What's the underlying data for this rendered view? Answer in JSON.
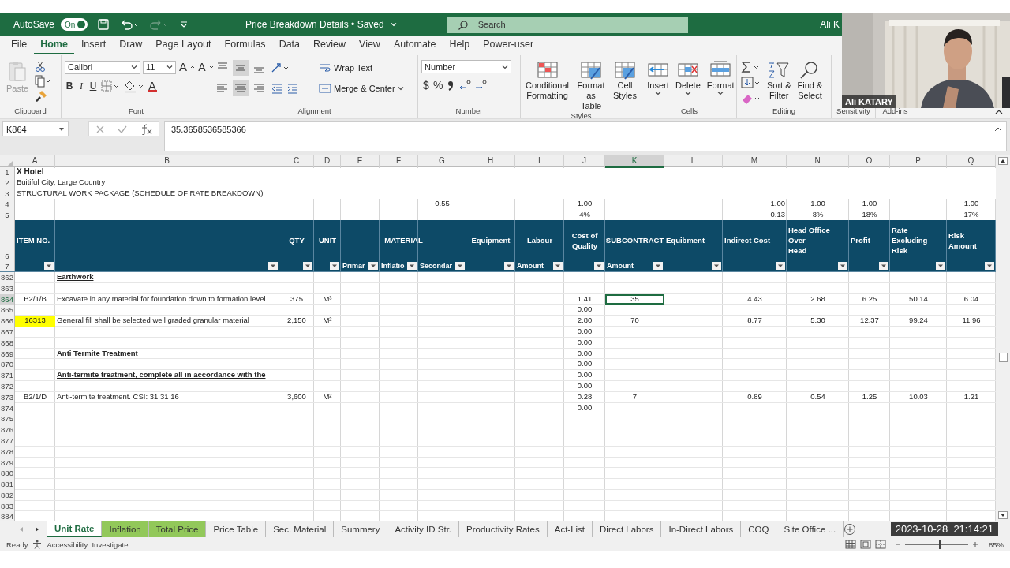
{
  "title_bar": {
    "autosave_label": "AutoSave",
    "autosave_on": true,
    "autosave_state": "On",
    "document_title": "Price Breakdown Details • Saved",
    "search_placeholder": "Search",
    "user_name": "Ali K"
  },
  "menu_tabs": [
    {
      "label": "File",
      "selected": false
    },
    {
      "label": "Home",
      "selected": true
    },
    {
      "label": "Insert",
      "selected": false
    },
    {
      "label": "Draw",
      "selected": false
    },
    {
      "label": "Page Layout",
      "selected": false
    },
    {
      "label": "Formulas",
      "selected": false
    },
    {
      "label": "Data",
      "selected": false
    },
    {
      "label": "Review",
      "selected": false
    },
    {
      "label": "View",
      "selected": false
    },
    {
      "label": "Automate",
      "selected": false
    },
    {
      "label": "Help",
      "selected": false
    },
    {
      "label": "Power-user",
      "selected": false
    }
  ],
  "ribbon": {
    "clipboard": {
      "label": "Clipboard",
      "paste": "Paste"
    },
    "font": {
      "label": "Font",
      "font_name": "Calibri",
      "font_size": "11",
      "grow": "A",
      "shrink": "A",
      "bold": "B",
      "italic": "I",
      "underline": "U",
      "font_color": "A"
    },
    "alignment": {
      "label": "Alignment",
      "wrap_text": "Wrap Text",
      "merge_center": "Merge & Center",
      "middle_align_on": true,
      "center_align_on": true
    },
    "number": {
      "label": "Number",
      "format": "Number",
      "currency": "$",
      "percent": "%"
    },
    "styles": {
      "label": "Styles",
      "buttons": [
        "Conditional\nFormatting",
        "Format as\nTable",
        "Cell\nStyles"
      ]
    },
    "cells": {
      "label": "Cells",
      "buttons": [
        "Insert",
        "Delete",
        "Format"
      ]
    },
    "editing": {
      "label": "Editing",
      "buttons": [
        "Sort &\nFilter",
        "Find &\nSelect"
      ]
    },
    "sensitivity": {
      "label": "Sensitivity"
    },
    "add_ins": {
      "label": "Add-ins"
    }
  },
  "webcam": {
    "name_label": "Ali KATARY"
  },
  "formula_bar": {
    "name_box": "K864",
    "formula": "35.3658536585366"
  },
  "columns": [
    {
      "letter": "A",
      "selected": false
    },
    {
      "letter": "B",
      "selected": false
    },
    {
      "letter": "C",
      "selected": false
    },
    {
      "letter": "D",
      "selected": false
    },
    {
      "letter": "E",
      "selected": false
    },
    {
      "letter": "F",
      "selected": false
    },
    {
      "letter": "G",
      "selected": false
    },
    {
      "letter": "H",
      "selected": false
    },
    {
      "letter": "I",
      "selected": false
    },
    {
      "letter": "J",
      "selected": false
    },
    {
      "letter": "K",
      "selected": true
    },
    {
      "letter": "L",
      "selected": false
    },
    {
      "letter": "M",
      "selected": false
    },
    {
      "letter": "N",
      "selected": false
    },
    {
      "letter": "O",
      "selected": false
    },
    {
      "letter": "P",
      "selected": false
    },
    {
      "letter": "Q",
      "selected": false
    }
  ],
  "top_rows": [
    {
      "row": "1",
      "kind": "title",
      "item_no": "X Hotel"
    },
    {
      "row": "2",
      "kind": "text",
      "item_no": "Buitiful City, Large Country"
    },
    {
      "row": "3",
      "kind": "text",
      "item_no": "STRUCTURAL WORK PACKAGE (SCHEDULE OF RATE BREAKDOWN)"
    },
    {
      "row": "4",
      "kind": "values",
      "secondary": "0.55",
      "cost_of_quality": "1.00",
      "indirect_cost": "1.00",
      "head_office_overhead": "1.00",
      "profit": "1.00",
      "risk_amount": "1.00"
    },
    {
      "row": "5",
      "kind": "values",
      "cost_of_quality": "4%",
      "indirect_cost": "0.13",
      "head_office_overhead": "8%",
      "profit": "18%",
      "risk_amount": "17%"
    }
  ],
  "header_row": {
    "row": "6",
    "cells": {
      "item_no": "ITEM NO.",
      "qty": "QTY",
      "unit": "UNIT",
      "material": "MATERIAL",
      "equipment": "Equipment",
      "labour": "Labour",
      "cost_of_quality": "Cost of\nQuality",
      "subcontract": "SUBCONTRACT",
      "equibment": "Equibment",
      "indirect_cost": "Indirect Cost",
      "head_office_overhead": "Head Office\nOver\nHead",
      "profit": "Profit",
      "rate_excluding_risk": "Rate\nExcluding Risk",
      "risk_amount": "Risk\nAmount"
    }
  },
  "filter_row": {
    "row": "7",
    "cells": {
      "primary": "Primar",
      "inflation": "Inflatio",
      "secondary": "Secondar",
      "labour": "Amount",
      "subcontract": "Amount"
    }
  },
  "rows": [
    {
      "row": "862",
      "selected": false,
      "heading": true,
      "description": "Earthwork"
    },
    {
      "row": "863",
      "selected": false
    },
    {
      "row": "864",
      "selected": true,
      "highlighted": false,
      "heading": false,
      "item_no": "B2/1/B",
      "description": "Excavate in any material for foundation down to formation level",
      "qty": "375",
      "unit": "M³",
      "cost_of_quality": "1.41",
      "subcontract": "35",
      "indirect_cost": "4.43",
      "head_office_overhead": "2.68",
      "profit": "6.25",
      "rate_excluding_risk": "50.14",
      "risk_amount": "6.04"
    },
    {
      "row": "865",
      "selected": false,
      "cost_of_quality": "0.00"
    },
    {
      "row": "866",
      "selected": false,
      "highlighted": true,
      "heading": false,
      "item_no": "16313",
      "description": "General fill shall be selected well graded granular material",
      "qty": "2,150",
      "unit": "M²",
      "cost_of_quality": "2.80",
      "subcontract": "70",
      "indirect_cost": "8.77",
      "head_office_overhead": "5.30",
      "profit": "12.37",
      "rate_excluding_risk": "99.24",
      "risk_amount": "11.96"
    },
    {
      "row": "867",
      "selected": false,
      "cost_of_quality": "0.00"
    },
    {
      "row": "868",
      "selected": false,
      "cost_of_quality": "0.00"
    },
    {
      "row": "869",
      "selected": false,
      "heading": true,
      "description": "Anti Termite Treatment",
      "cost_of_quality": "0.00"
    },
    {
      "row": "870",
      "selected": false,
      "cost_of_quality": "0.00"
    },
    {
      "row": "871",
      "selected": false,
      "heading": true,
      "description": "Anti-termite treatment, complete all in accordance with the ",
      "cost_of_quality": "0.00"
    },
    {
      "row": "872",
      "selected": false,
      "cost_of_quality": "0.00"
    },
    {
      "row": "873",
      "selected": false,
      "highlighted": false,
      "heading": false,
      "item_no": "B2/1/D",
      "description": "Anti-termite treatment. CSI: 31 31 16",
      "qty": "3,600",
      "unit": "M²",
      "cost_of_quality": "0.28",
      "subcontract": "7",
      "indirect_cost": "0.89",
      "head_office_overhead": "0.54",
      "profit": "1.25",
      "rate_excluding_risk": "10.03",
      "risk_amount": "1.21"
    },
    {
      "row": "874",
      "selected": false,
      "cost_of_quality": "0.00"
    },
    {
      "row": "875",
      "selected": false
    },
    {
      "row": "876",
      "selected": false
    },
    {
      "row": "877",
      "selected": false
    },
    {
      "row": "878",
      "selected": false
    },
    {
      "row": "879",
      "selected": false
    },
    {
      "row": "880",
      "selected": false
    },
    {
      "row": "881",
      "selected": false
    },
    {
      "row": "882",
      "selected": false
    },
    {
      "row": "883",
      "selected": false
    },
    {
      "row": "884",
      "selected": false
    }
  ],
  "sheet_tabs": [
    {
      "label": "Unit Rate",
      "selected": true
    },
    {
      "label": "Inflation",
      "selected": false,
      "color": "#92c85a"
    },
    {
      "label": "Total Price",
      "selected": false,
      "color": "#92c85a"
    },
    {
      "label": "Price Table",
      "selected": false
    },
    {
      "label": "Sec. Material",
      "selected": false
    },
    {
      "label": "Summery",
      "selected": false
    },
    {
      "label": "Activity ID Str.",
      "selected": false
    },
    {
      "label": "Productivity Rates",
      "selected": false
    },
    {
      "label": "Act-List",
      "selected": false
    },
    {
      "label": "Direct Labors",
      "selected": false
    },
    {
      "label": "In-Direct Labors",
      "selected": false
    },
    {
      "label": "COQ",
      "selected": false
    },
    {
      "label": "Site Office ...",
      "selected": false
    }
  ],
  "timestamp": "2023-10-28  21:14:21",
  "status_bar": {
    "status": "Ready",
    "accessibility": "Accessibility: Investigate",
    "zoom": {
      "level": 0.55,
      "reading": "85%"
    }
  }
}
